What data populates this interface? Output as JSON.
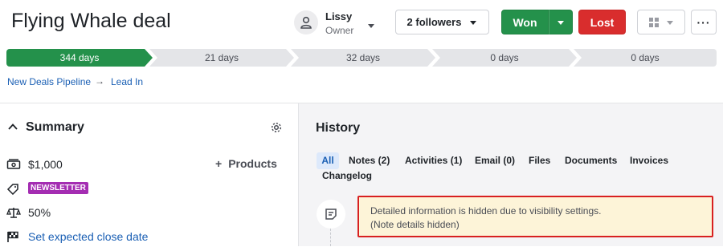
{
  "header": {
    "title": "Flying Whale deal",
    "owner_name": "Lissy",
    "owner_role": "Owner",
    "followers_label": "2 followers",
    "won_label": "Won",
    "lost_label": "Lost",
    "more_label": "···"
  },
  "pipeline": {
    "stages": [
      {
        "label": "344 days",
        "active": true
      },
      {
        "label": "21 days",
        "active": false
      },
      {
        "label": "32 days",
        "active": false
      },
      {
        "label": "0 days",
        "active": false
      },
      {
        "label": "0 days",
        "active": false
      }
    ],
    "accent_color": "#24914b"
  },
  "breadcrumb": {
    "pipeline": "New Deals Pipeline",
    "arrow": "→",
    "stage": "Lead In"
  },
  "summary": {
    "title": "Summary",
    "value": "$1,000",
    "products_label": "Products",
    "products_plus": "+",
    "label_badge": "NEWSLETTER",
    "label_badge_color": "#a42db2",
    "probability": "50%",
    "close_date_link": "Set expected close date"
  },
  "history": {
    "title": "History",
    "tabs": [
      "All",
      "Notes (2)",
      "Activities (1)",
      "Email (0)",
      "Files",
      "Documents",
      "Invoices",
      "Changelog"
    ],
    "note_line1": "Detailed information is hidden due to visibility settings.",
    "note_line2": "(Note details hidden)"
  },
  "colors": {
    "won": "#24914b",
    "lost": "#d92d2d",
    "link": "#1a5fb4",
    "highlight_border": "#d82020",
    "note_bg": "#fdf4d8"
  }
}
